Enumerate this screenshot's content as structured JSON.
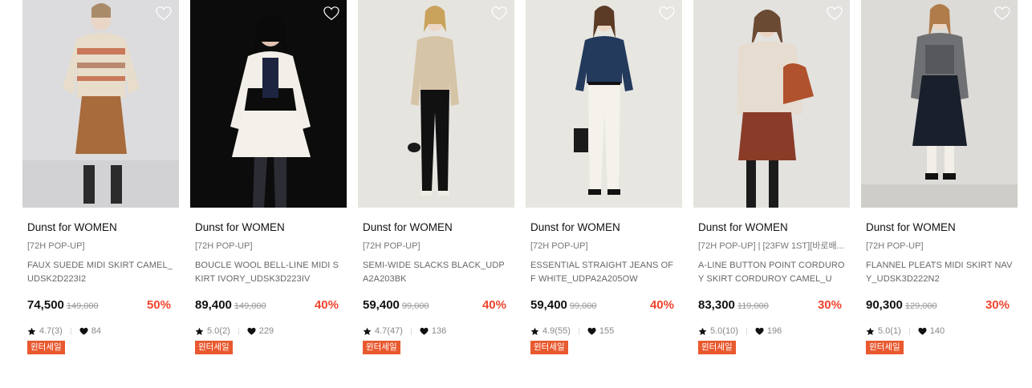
{
  "colors": {
    "discount": "#f0432c",
    "badge_bg": "#e9592f"
  },
  "products": [
    {
      "brand": "Dunst for WOMEN",
      "tag": "[72H POP-UP]",
      "name": "FAUX SUEDE MIDI SKIRT CAMEL_UDSK2D223I2",
      "price": "74,500",
      "original_price": "149,000",
      "discount": "50%",
      "rating": "4.7(3)",
      "likes": "84",
      "badge": "윈터세일",
      "image_icon": "product-photo-icon"
    },
    {
      "brand": "Dunst for WOMEN",
      "tag": "[72H POP-UP]",
      "name": "BOUCLE WOOL BELL-LINE MIDI SKIRT IVORY_UDSK3D223IV",
      "price": "89,400",
      "original_price": "149,000",
      "discount": "40%",
      "rating": "5.0(2)",
      "likes": "229",
      "badge": "윈터세일",
      "image_icon": "product-photo-icon"
    },
    {
      "brand": "Dunst for WOMEN",
      "tag": "[72H POP-UP]",
      "name": "SEMI-WIDE SLACKS BLACK_UDPA2A203BK",
      "price": "59,400",
      "original_price": "99,000",
      "discount": "40%",
      "rating": "4.7(47)",
      "likes": "136",
      "badge": "윈터세일",
      "image_icon": "product-photo-icon"
    },
    {
      "brand": "Dunst for WOMEN",
      "tag": "[72H POP-UP]",
      "name": "ESSENTIAL STRAIGHT JEANS OFF WHITE_UDPA2A205OW",
      "price": "59,400",
      "original_price": "99,000",
      "discount": "40%",
      "rating": "4.9(55)",
      "likes": "155",
      "badge": "윈터세일",
      "image_icon": "product-photo-icon"
    },
    {
      "brand": "Dunst for WOMEN",
      "tag": "[72H POP-UP] | [23FW 1ST][바로배...",
      "name": "A-LINE BUTTON POINT CORDUROY SKIRT CORDUROY CAMEL_UD...",
      "price": "83,300",
      "original_price": "119,000",
      "discount": "30%",
      "rating": "5.0(10)",
      "likes": "196",
      "badge": "윈터세일",
      "image_icon": "product-photo-icon"
    },
    {
      "brand": "Dunst for WOMEN",
      "tag": "[72H POP-UP]",
      "name": "FLANNEL PLEATS MIDI SKIRT NAVY_UDSK3D222N2",
      "price": "90,300",
      "original_price": "129,000",
      "discount": "30%",
      "rating": "5.0(1)",
      "likes": "140",
      "badge": "윈터세일",
      "image_icon": "product-photo-icon"
    }
  ]
}
